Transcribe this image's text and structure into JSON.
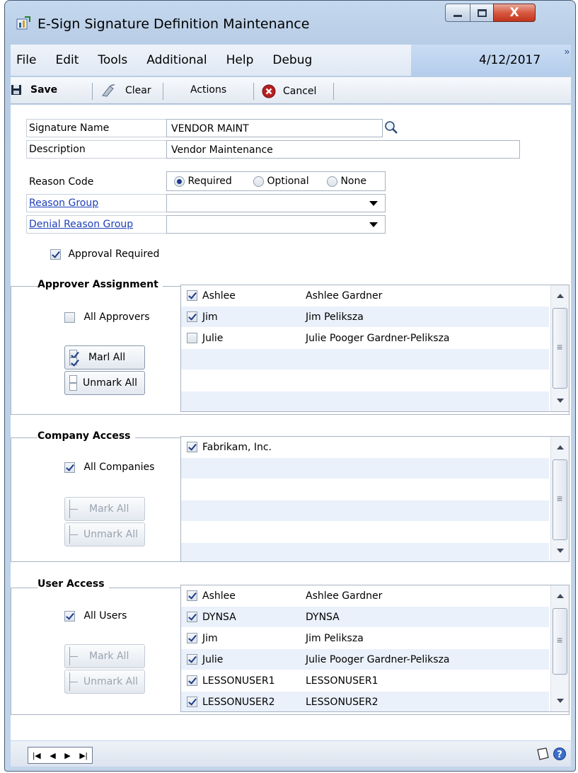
{
  "window": {
    "title": "E-Sign Signature Definition Maintenance"
  },
  "menu": {
    "items": [
      "File",
      "Edit",
      "Tools",
      "Additional",
      "Help",
      "Debug"
    ],
    "date": "4/12/2017"
  },
  "toolbar": {
    "save": "Save",
    "clear": "Clear",
    "actions": "Actions",
    "cancel": "Cancel"
  },
  "form": {
    "signature_name_label": "Signature Name",
    "signature_name": "VENDOR MAINT",
    "description_label": "Description",
    "description": "Vendor Maintenance",
    "reason_code_label": "Reason Code",
    "reason_options": [
      "Required",
      "Optional",
      "None"
    ],
    "reason_selected": "Required",
    "reason_group_label": "Reason Group",
    "reason_group": "",
    "denial_reason_group_label": "Denial Reason Group",
    "denial_reason_group": "",
    "approval_required_label": "Approval Required",
    "approval_required": true
  },
  "approver": {
    "title": "Approver Assignment",
    "all_label": "All Approvers",
    "all_checked": false,
    "mark_all": "Marl All",
    "unmark_all": "Unmark All",
    "rows": [
      {
        "id": "Ashlee",
        "name": "Ashlee Gardner",
        "checked": true
      },
      {
        "id": "Jim",
        "name": "Jim Peliksza",
        "checked": true
      },
      {
        "id": "Julie",
        "name": "Julie Pooger Gardner-Peliksza",
        "checked": false
      }
    ]
  },
  "company": {
    "title": "Company Access",
    "all_label": "All Companies",
    "all_checked": true,
    "mark_all": "Mark All",
    "unmark_all": "Unmark All",
    "rows": [
      {
        "id": "Fabrikam, Inc.",
        "name": "",
        "checked": true
      }
    ]
  },
  "users": {
    "title": "User Access",
    "all_label": "All Users",
    "all_checked": true,
    "mark_all": "Mark All",
    "unmark_all": "Unmark All",
    "rows": [
      {
        "id": "Ashlee",
        "name": "Ashlee Gardner",
        "checked": true
      },
      {
        "id": "DYNSA",
        "name": "DYNSA",
        "checked": true
      },
      {
        "id": "Jim",
        "name": "Jim Peliksza",
        "checked": true
      },
      {
        "id": "Julie",
        "name": "Julie Pooger Gardner-Peliksza",
        "checked": true
      },
      {
        "id": "LESSONUSER1",
        "name": "LESSONUSER1",
        "checked": true
      },
      {
        "id": "LESSONUSER2",
        "name": "LESSONUSER2",
        "checked": true
      }
    ]
  },
  "colors": {
    "accent": "#1d3fb8",
    "row_alt": "#eaf1fb",
    "window_frame": "#c4d8ee"
  },
  "icons": [
    "app-icon",
    "minimize-icon",
    "maximize-icon",
    "close-icon",
    "save-icon",
    "clear-icon",
    "cancel-icon",
    "lookup-icon",
    "dropdown-icon",
    "note-icon",
    "help-icon"
  ]
}
